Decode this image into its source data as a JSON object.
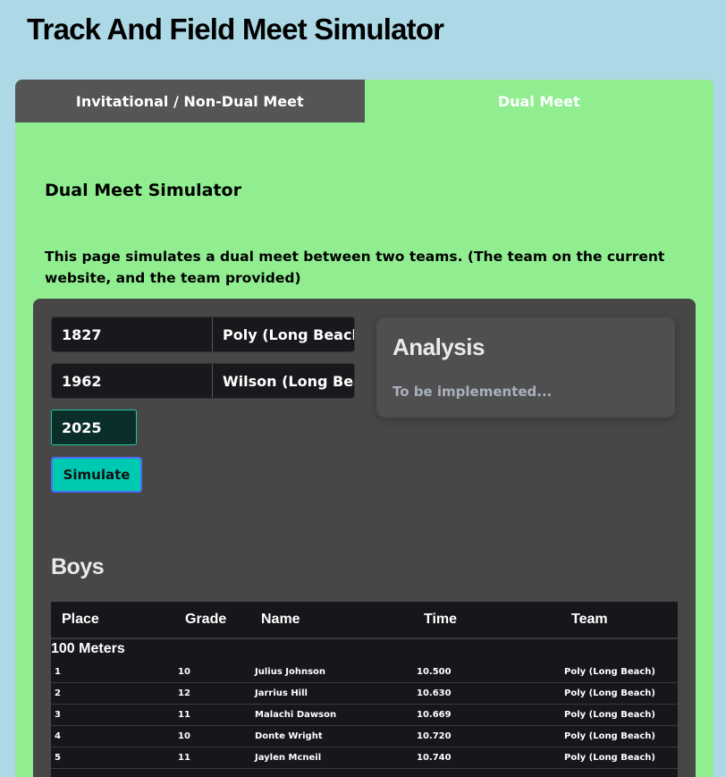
{
  "page": {
    "title": "Track And Field Meet Simulator"
  },
  "tabs": [
    {
      "label": "Invitational / Non-Dual Meet",
      "active": false
    },
    {
      "label": "Dual Meet",
      "active": true
    }
  ],
  "simulator": {
    "title": "Dual Meet Simulator",
    "description": "This page simulates a dual meet between two teams. (The team on the current website, and the team provided)",
    "team1": {
      "code": "1827",
      "name": "Poly (Long Beach)"
    },
    "team2": {
      "code": "1962",
      "name": "Wilson (Long Beach)"
    },
    "year": "2025",
    "simulate_label": "Simulate"
  },
  "analysis": {
    "title": "Analysis",
    "text": "To be implemented..."
  },
  "boys": {
    "title": "Boys",
    "columns": [
      "Place",
      "Grade",
      "Name",
      "Time",
      "Team"
    ],
    "event": "100 Meters",
    "rows": [
      {
        "place": "1",
        "grade": "10",
        "name": "Julius Johnson",
        "time": "10.500",
        "team": "Poly (Long Beach)"
      },
      {
        "place": "2",
        "grade": "12",
        "name": "Jarrius Hill",
        "time": "10.630",
        "team": "Poly (Long Beach)"
      },
      {
        "place": "3",
        "grade": "11",
        "name": "Malachi Dawson",
        "time": "10.669",
        "team": "Poly (Long Beach)"
      },
      {
        "place": "4",
        "grade": "10",
        "name": "Donte Wright",
        "time": "10.720",
        "team": "Poly (Long Beach)"
      },
      {
        "place": "5",
        "grade": "11",
        "name": "Jaylen Mcneil",
        "time": "10.740",
        "team": "Poly (Long Beach)"
      }
    ]
  },
  "colors": {
    "background": "#add8e6",
    "card": "#90ee90",
    "inactive_tab": "#555555",
    "panel": "#474747",
    "accent": "#00c9b1"
  }
}
